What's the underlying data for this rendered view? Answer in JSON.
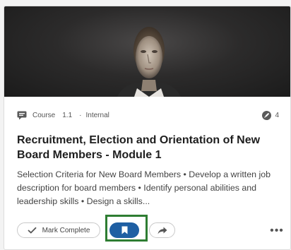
{
  "card": {
    "type_label": "Course",
    "version": "1.1",
    "separator": "·",
    "visibility": "Internal",
    "stat_count": "4",
    "title": "Recruitment, Election and Orientation of New Board Members - Module 1",
    "description": "Selection Criteria for New Board Members • Develop a written job description for board members • Identify personal abilities and leadership skills • Design a skills...",
    "actions": {
      "mark_complete_label": "Mark Complete",
      "more_label": "•••"
    },
    "icons": {
      "type": "course-icon",
      "stat": "rocket-icon",
      "mark": "check-icon",
      "bookmark": "bookmark-icon",
      "share": "share-icon",
      "more": "more-icon"
    },
    "colors": {
      "bookmark_button": "#1f5fa3",
      "highlight_border": "#2e7d32"
    }
  }
}
